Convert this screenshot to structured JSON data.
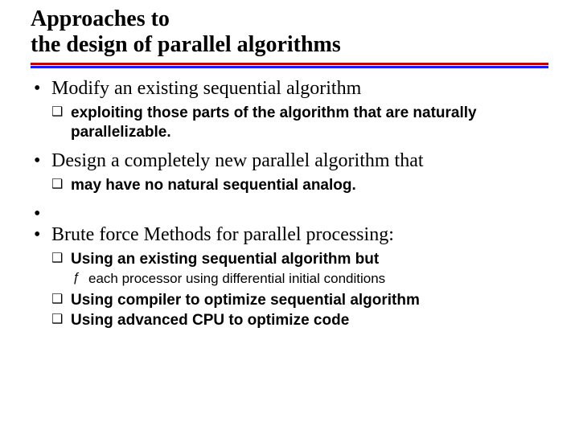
{
  "title_line1": "Approaches to",
  "title_line2": "the design of parallel algorithms",
  "items": [
    {
      "text": "Modify an existing sequential algorithm",
      "sub": [
        {
          "text": "exploiting those parts of the algorithm that are naturally parallelizable."
        }
      ]
    },
    {
      "text": "Design a completely new parallel algorithm that",
      "sub": [
        {
          "text": "may have no natural sequential analog."
        }
      ]
    },
    {
      "text": "Brute force Methods for parallel processing:",
      "sub": [
        {
          "text": "Using an existing sequential algorithm but",
          "subsub": [
            {
              "text": "each processor using differential initial conditions"
            }
          ]
        },
        {
          "text": "Using compiler to optimize sequential algorithm"
        },
        {
          "text": "Using advanced CPU to optimize code"
        }
      ]
    }
  ]
}
